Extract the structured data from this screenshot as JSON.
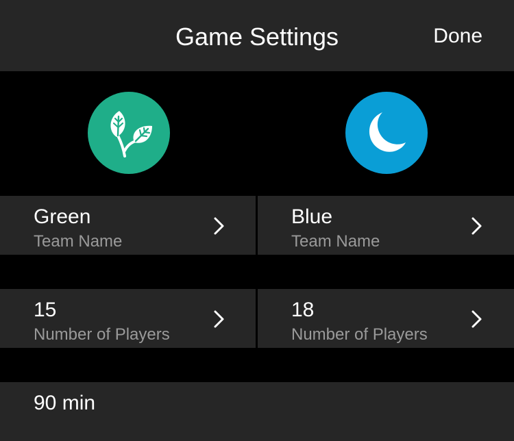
{
  "header": {
    "title": "Game Settings",
    "done_label": "Done"
  },
  "teams": [
    {
      "icon": "leaf-icon",
      "color": "#1fae89",
      "name": "Green",
      "name_label": "Team Name",
      "players": "15",
      "players_label": "Number of Players"
    },
    {
      "icon": "moon-icon",
      "color": "#0a9ed6",
      "name": "Blue",
      "name_label": "Team Name",
      "players": "18",
      "players_label": "Number of Players"
    }
  ],
  "game": {
    "duration": "90 min"
  },
  "colors": {
    "background": "#000000",
    "cell": "#262626",
    "secondary_text": "#9a9a9a"
  }
}
